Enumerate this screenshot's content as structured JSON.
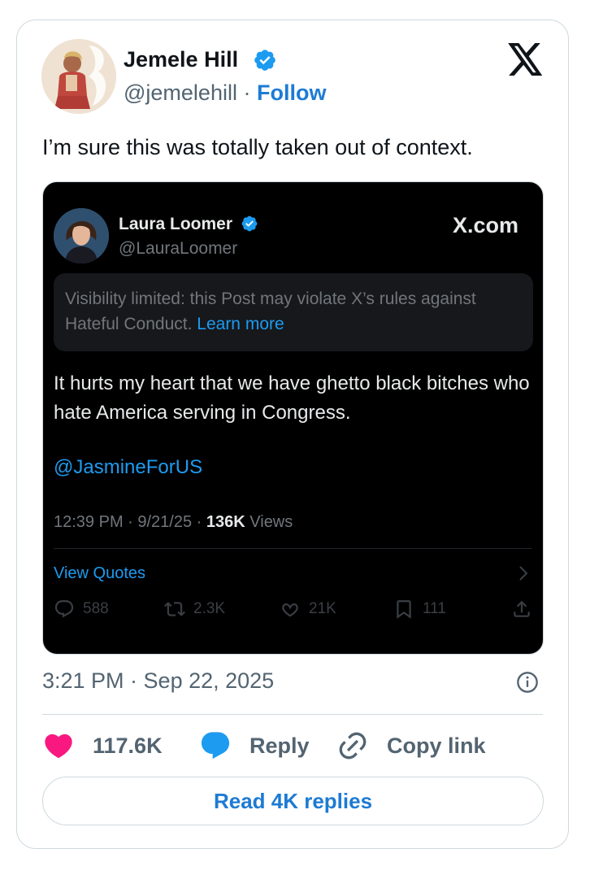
{
  "author": {
    "name": "Jemele Hill",
    "handle": "@jemelehill",
    "separator": "·",
    "follow_label": "Follow"
  },
  "tweet": {
    "text": "I’m sure this was totally taken out of context."
  },
  "embedded_post": {
    "name": "Laura Loomer",
    "handle": "@LauraLoomer",
    "brand": "X.com",
    "notice_text": "Visibility limited: this Post may violate X’s rules against Hateful Conduct.",
    "notice_link": "Learn more",
    "body": "It hurts my heart that we have ghetto black bitches who hate America serving in Congress.",
    "mention": "@JasmineForUS",
    "time": "12:39 PM · 9/21/25 ·",
    "views_count": "136K",
    "views_label": "Views",
    "view_quotes_label": "View Quotes",
    "actions": {
      "replies": "588",
      "reposts": "2.3K",
      "likes": "21K",
      "bookmarks": "111"
    }
  },
  "timestamp": "3:21 PM · Sep 22, 2025",
  "actions": {
    "like_count": "117.6K",
    "reply_label": "Reply",
    "copy_label": "Copy link"
  },
  "read_replies_label": "Read 4K replies",
  "colors": {
    "accent": "#1d7bd4",
    "heart": "#f91880",
    "verified": "#1d9bf0",
    "embed_bg": "#000000"
  }
}
